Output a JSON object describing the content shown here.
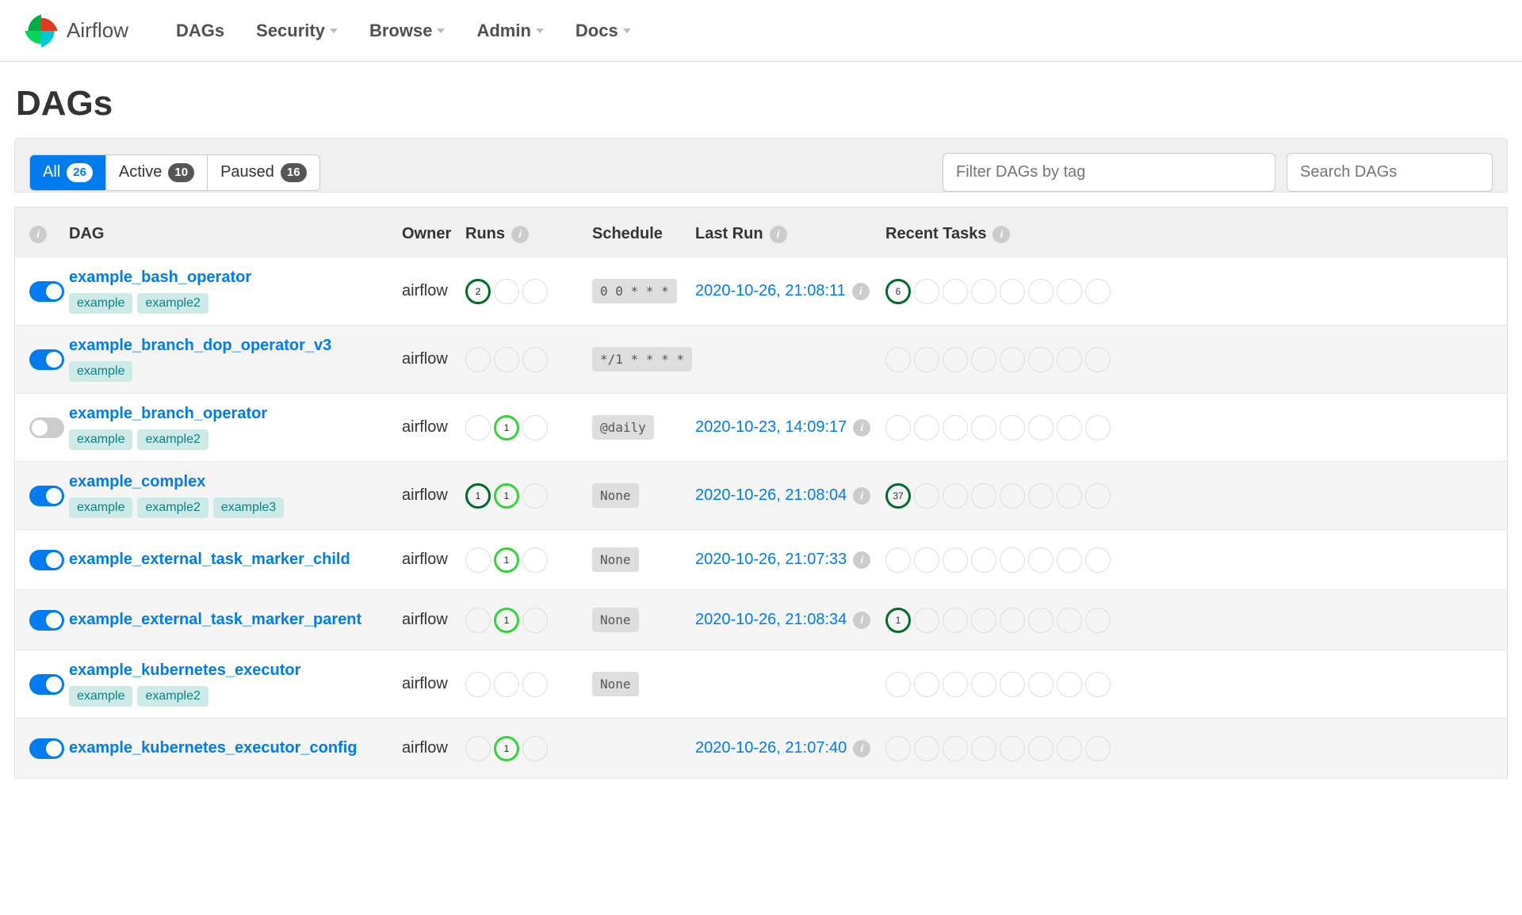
{
  "brand": "Airflow",
  "nav": {
    "dags": "DAGs",
    "security": "Security",
    "browse": "Browse",
    "admin": "Admin",
    "docs": "Docs"
  },
  "pageTitle": "DAGs",
  "filters": {
    "all": {
      "label": "All",
      "count": "26"
    },
    "active": {
      "label": "Active",
      "count": "10"
    },
    "paused": {
      "label": "Paused",
      "count": "16"
    },
    "tagPlaceholder": "Filter DAGs by tag",
    "searchPlaceholder": "Search DAGs"
  },
  "headers": {
    "dag": "DAG",
    "owner": "Owner",
    "runs": "Runs",
    "schedule": "Schedule",
    "lastRun": "Last Run",
    "recentTasks": "Recent Tasks"
  },
  "rows": [
    {
      "name": "example_bash_operator",
      "on": true,
      "tags": [
        "example",
        "example2"
      ],
      "owner": "airflow",
      "runs": [
        {
          "v": "2",
          "s": "success"
        },
        {
          "v": "",
          "s": ""
        },
        {
          "v": "",
          "s": ""
        }
      ],
      "sched": "0 0 * * *",
      "lastRun": "2020-10-26, 21:08:11",
      "tasks": [
        {
          "v": "6",
          "s": "success"
        }
      ]
    },
    {
      "name": "example_branch_dop_operator_v3",
      "on": true,
      "tags": [
        "example"
      ],
      "owner": "airflow",
      "runs": [
        {
          "v": "",
          "s": ""
        },
        {
          "v": "",
          "s": ""
        },
        {
          "v": "",
          "s": ""
        }
      ],
      "sched": "*/1 * * * *",
      "lastRun": "",
      "tasks": []
    },
    {
      "name": "example_branch_operator",
      "on": false,
      "tags": [
        "example",
        "example2"
      ],
      "owner": "airflow",
      "runs": [
        {
          "v": "",
          "s": ""
        },
        {
          "v": "1",
          "s": "running"
        },
        {
          "v": "",
          "s": ""
        }
      ],
      "sched": "@daily",
      "lastRun": "2020-10-23, 14:09:17",
      "tasks": []
    },
    {
      "name": "example_complex",
      "on": true,
      "tags": [
        "example",
        "example2",
        "example3"
      ],
      "owner": "airflow",
      "runs": [
        {
          "v": "1",
          "s": "success"
        },
        {
          "v": "1",
          "s": "running"
        },
        {
          "v": "",
          "s": ""
        }
      ],
      "sched": "None",
      "lastRun": "2020-10-26, 21:08:04",
      "tasks": [
        {
          "v": "37",
          "s": "success"
        }
      ]
    },
    {
      "name": "example_external_task_marker_child",
      "on": true,
      "tags": [],
      "owner": "airflow",
      "runs": [
        {
          "v": "",
          "s": ""
        },
        {
          "v": "1",
          "s": "running"
        },
        {
          "v": "",
          "s": ""
        }
      ],
      "sched": "None",
      "lastRun": "2020-10-26, 21:07:33",
      "tasks": []
    },
    {
      "name": "example_external_task_marker_parent",
      "on": true,
      "tags": [],
      "owner": "airflow",
      "runs": [
        {
          "v": "",
          "s": ""
        },
        {
          "v": "1",
          "s": "running"
        },
        {
          "v": "",
          "s": ""
        }
      ],
      "sched": "None",
      "lastRun": "2020-10-26, 21:08:34",
      "tasks": [
        {
          "v": "1",
          "s": "success"
        }
      ]
    },
    {
      "name": "example_kubernetes_executor",
      "on": true,
      "tags": [
        "example",
        "example2"
      ],
      "owner": "airflow",
      "runs": [
        {
          "v": "",
          "s": ""
        },
        {
          "v": "",
          "s": ""
        },
        {
          "v": "",
          "s": ""
        }
      ],
      "sched": "None",
      "lastRun": "",
      "tasks": []
    },
    {
      "name": "example_kubernetes_executor_config",
      "on": true,
      "tags": [],
      "owner": "airflow",
      "runs": [
        {
          "v": "",
          "s": ""
        },
        {
          "v": "1",
          "s": "running"
        },
        {
          "v": "",
          "s": ""
        }
      ],
      "sched": "",
      "lastRun": "2020-10-26, 21:07:40",
      "tasks": []
    }
  ]
}
